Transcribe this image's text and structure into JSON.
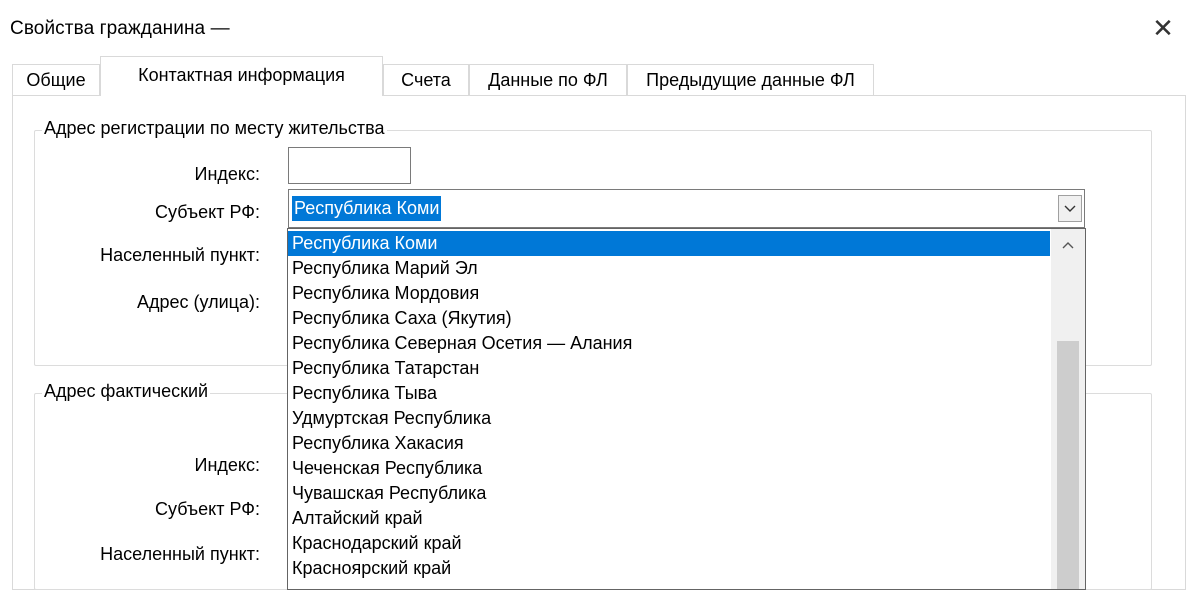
{
  "window": {
    "title": "Свойства гражданина —",
    "close_glyph": "✕"
  },
  "tabs": [
    {
      "label": "Общие",
      "active": false
    },
    {
      "label": "Контактная информация",
      "active": true
    },
    {
      "label": "Счета",
      "active": false
    },
    {
      "label": "Данные по ФЛ",
      "active": false
    },
    {
      "label": "Предыдущие данные ФЛ",
      "active": false
    }
  ],
  "registration_address": {
    "group_title": "Адрес регистрации по месту жительства",
    "index_label": "Индекс:",
    "index_value": "",
    "subject_label": "Субъект РФ:",
    "subject_value": "Республика Коми",
    "locality_label": "Населенный пункт:",
    "street_label": "Адрес (улица):"
  },
  "actual_address": {
    "group_title": "Адрес фактический",
    "index_label": "Индекс:",
    "subject_label": "Субъект РФ:",
    "locality_label": "Населенный пункт:"
  },
  "dropdown": {
    "selected_index": 0,
    "items": [
      "Республика Коми",
      "Республика Марий Эл",
      "Республика Мордовия",
      "Республика Саха (Якутия)",
      "Республика Северная Осетия — Алания",
      "Республика Татарстан",
      "Республика Тыва",
      "Удмуртская Республика",
      "Республика Хакасия",
      "Чеченская Республика",
      "Чувашская Республика",
      "Алтайский край",
      "Краснодарский край",
      "Красноярский край"
    ]
  },
  "icons": {
    "close": "close-icon",
    "combo_arrow": "chevron-down-icon",
    "scroll_up": "chevron-up-icon"
  },
  "colors": {
    "selection": "#0078d7",
    "scroll_track": "#f0f0f0",
    "scroll_thumb": "#cdcdcd"
  }
}
